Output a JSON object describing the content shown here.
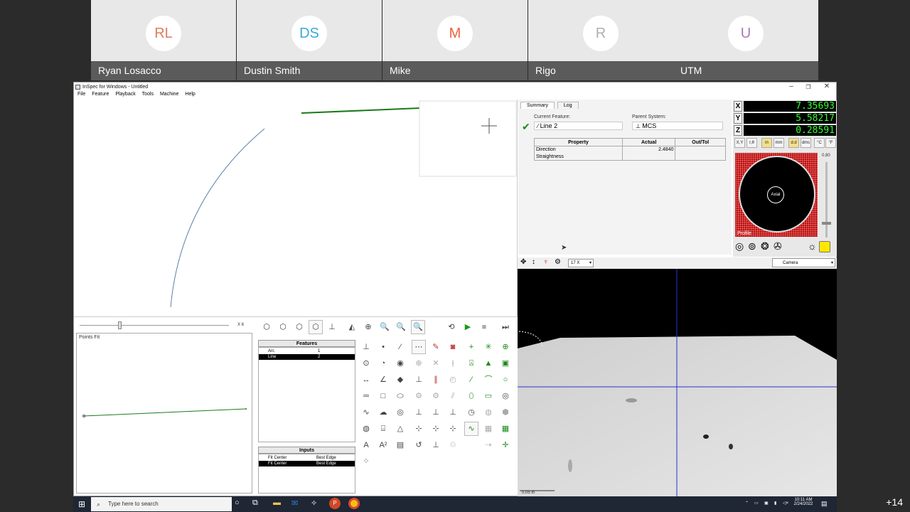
{
  "participants": [
    {
      "initials": "RL",
      "name": "Ryan Losacco",
      "color": "#e07a5f"
    },
    {
      "initials": "DS",
      "name": "Dustin Smith",
      "color": "#3aa8d8"
    },
    {
      "initials": "M",
      "name": "Mike",
      "color": "#e8643c"
    },
    {
      "initials": "R",
      "name": "Rigo",
      "color": "#b0b0b0"
    },
    {
      "initials": "U",
      "name": "UTM",
      "color": "#a97ab8"
    }
  ],
  "more_participants": "+14",
  "window": {
    "title": "InSpec for Windows - Untitled",
    "menu": [
      "File",
      "Feature",
      "Playback",
      "Tools",
      "Machine",
      "Help"
    ]
  },
  "summary": {
    "tabs": [
      "Summary",
      "Log"
    ],
    "current_feature_label": "Current Feature:",
    "current_feature": "Line 2",
    "parent_system_label": "Parent System:",
    "parent_system": "MCS",
    "table_headers": [
      "Property",
      "Actual",
      "Out/Tol"
    ],
    "rows": [
      {
        "property": "Direction",
        "actual": "2.4840",
        "outtol": ""
      },
      {
        "property": "Straightness",
        "actual": "",
        "outtol": ""
      }
    ]
  },
  "dro": {
    "x_label": "X",
    "x": "7.35693",
    "y_label": "Y",
    "y": "5.58217",
    "z_label": "Z",
    "z": "0.28591",
    "buttons": [
      "X,Y",
      "r,θ",
      "in",
      "mm",
      "d.d",
      "dms",
      "°C",
      "°F"
    ]
  },
  "light": {
    "center_label": "Axial",
    "mode_label": "Profile",
    "level": "0.80"
  },
  "camera": {
    "zoom": "17 X",
    "source": "Camera",
    "scale_label": "0.05 in"
  },
  "points_fit": {
    "label": "Points Fit",
    "zoom_label": "X 6"
  },
  "features": {
    "header": "Features",
    "items": [
      {
        "name": "Arc",
        "num": "1"
      },
      {
        "name": "Line",
        "num": "2"
      }
    ]
  },
  "inputs": {
    "header": "Inputs",
    "items": [
      {
        "name": "Fit Center",
        "mode": "Best Edge"
      },
      {
        "name": "Fit Center",
        "mode": "Best Edge"
      }
    ]
  },
  "taskbar": {
    "search_placeholder": "Type here to search",
    "time": "10:11 AM",
    "date": "2/24/2022"
  },
  "colors": {
    "dro_green": "#33ff33",
    "light_red": "#b01515",
    "meeting_bg": "#2b2b2b"
  }
}
